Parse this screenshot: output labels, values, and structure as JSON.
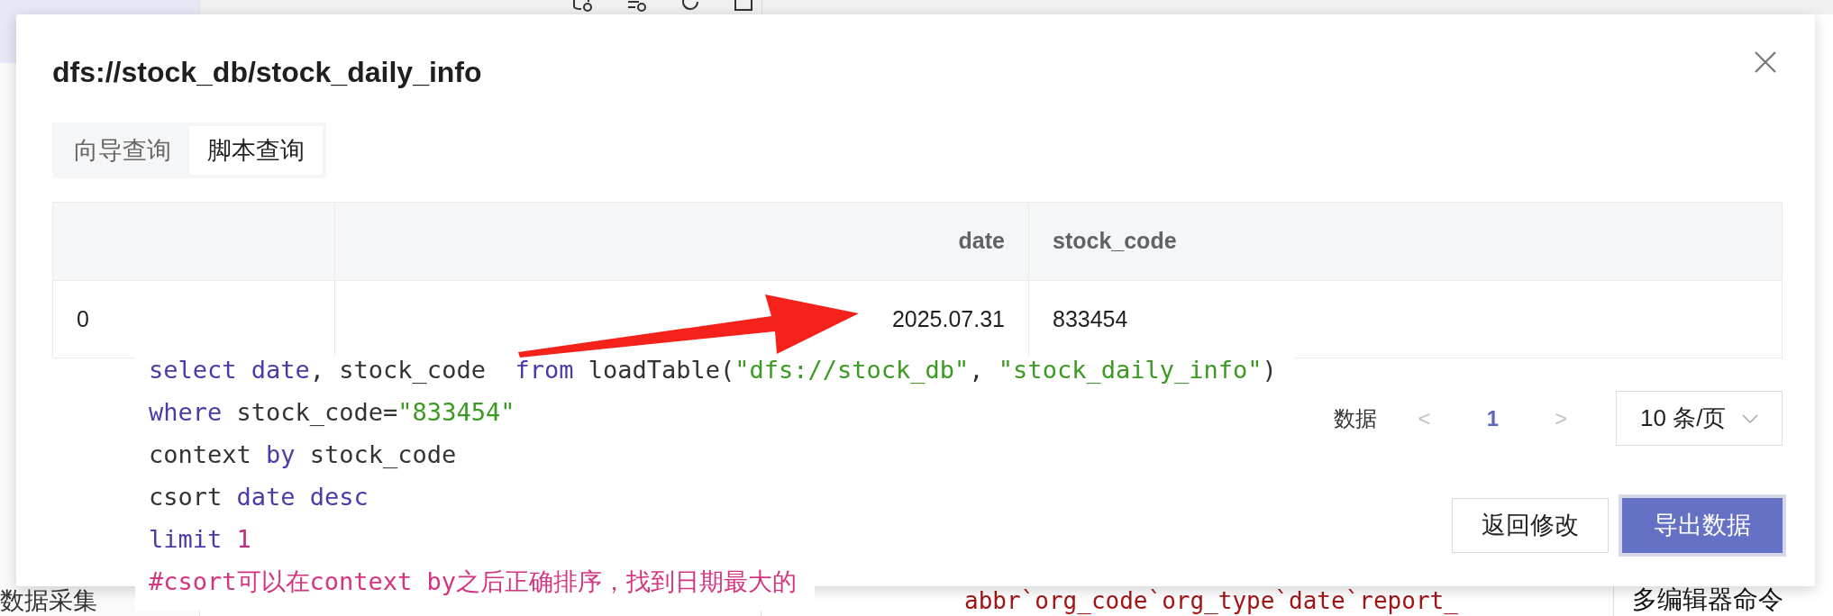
{
  "background": {
    "sidebar_items": [
      {
        "label": "数据采集"
      }
    ],
    "editor_fragment": "abbr`org_code`org_type`date`report_",
    "panel_fragment": "多编辑器命令"
  },
  "dialog": {
    "title": "dfs://stock_db/stock_daily_info",
    "tabs": [
      {
        "label": "向导查询",
        "selected": false
      },
      {
        "label": "脚本查询",
        "selected": true
      }
    ],
    "table": {
      "columns": [
        {
          "label": "date"
        },
        {
          "label": "stock_code"
        }
      ],
      "rows": [
        {
          "index": "0",
          "cells": [
            "2025.07.31",
            "833454"
          ]
        }
      ]
    },
    "pagination": {
      "total_fragment": "数据",
      "prev": "<",
      "next": ">",
      "pages": [
        {
          "label": "1",
          "selected": true
        }
      ],
      "page_size": "10 条/页"
    },
    "buttons": [
      {
        "label": "返回修改",
        "kind": "secondary"
      },
      {
        "label": "导出数据",
        "kind": "primary"
      }
    ]
  },
  "code_snippet": {
    "lines": [
      [
        {
          "text": "select ",
          "kind": "keyword"
        },
        {
          "text": "date",
          "kind": "keyword"
        },
        {
          "text": ", stock_code  ",
          "kind": "plain"
        },
        {
          "text": "from",
          "kind": "keyword"
        },
        {
          "text": " loadTable(",
          "kind": "plain"
        },
        {
          "text": "\"dfs://stock_db\"",
          "kind": "string"
        },
        {
          "text": ", ",
          "kind": "plain"
        },
        {
          "text": "\"stock_daily_info\"",
          "kind": "string"
        },
        {
          "text": ")",
          "kind": "plain"
        }
      ],
      [
        {
          "text": "where",
          "kind": "keyword"
        },
        {
          "text": " stock_code=",
          "kind": "plain"
        },
        {
          "text": "\"833454\"",
          "kind": "string"
        }
      ],
      [
        {
          "text": "context ",
          "kind": "plain"
        },
        {
          "text": "by",
          "kind": "keyword"
        },
        {
          "text": " stock_code",
          "kind": "plain"
        }
      ],
      [
        {
          "text": "csort ",
          "kind": "plain"
        },
        {
          "text": "date desc",
          "kind": "keyword"
        }
      ],
      [
        {
          "text": "limit ",
          "kind": "keyword"
        },
        {
          "text": "1",
          "kind": "number"
        }
      ],
      [
        {
          "text": "#csort可以在context by之后正确排序，找到日期最大的",
          "kind": "comment"
        }
      ]
    ]
  }
}
